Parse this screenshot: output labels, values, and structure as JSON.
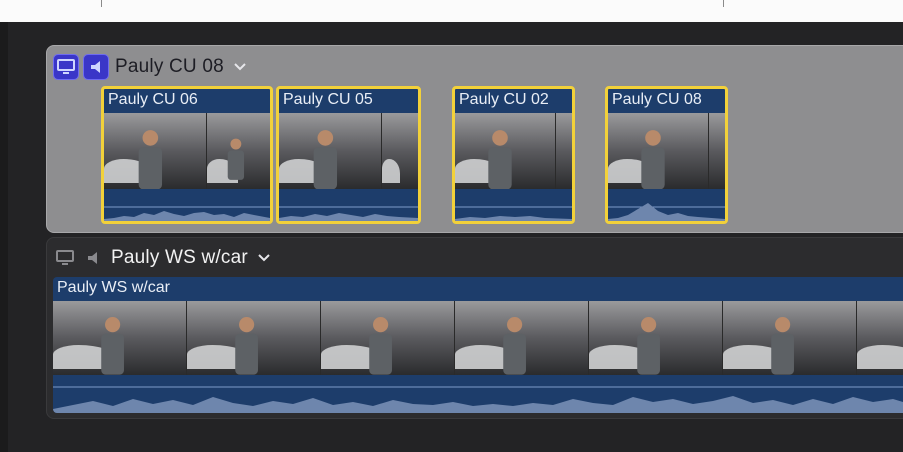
{
  "angles": [
    {
      "name": "Pauly CU 08",
      "video_enabled": true,
      "audio_enabled": true,
      "clips": [
        {
          "label": "Pauly CU 06",
          "selected": true
        },
        {
          "label": "Pauly CU 05",
          "selected": true
        },
        {
          "label": "Pauly CU 02",
          "selected": true
        },
        {
          "label": "Pauly CU 08",
          "selected": true
        }
      ]
    },
    {
      "name": "Pauly WS w/car",
      "video_enabled": false,
      "audio_enabled": false,
      "clips": [
        {
          "label": "Pauly WS w/car",
          "selected": false
        }
      ]
    }
  ],
  "icons": {
    "video": "monitor-icon",
    "audio": "speaker-icon",
    "menu": "chevron-down-icon"
  },
  "colors": {
    "selection": "#f2d13a",
    "clip_fill": "#1d3d6b",
    "active_toggle": "#3a36c8"
  }
}
